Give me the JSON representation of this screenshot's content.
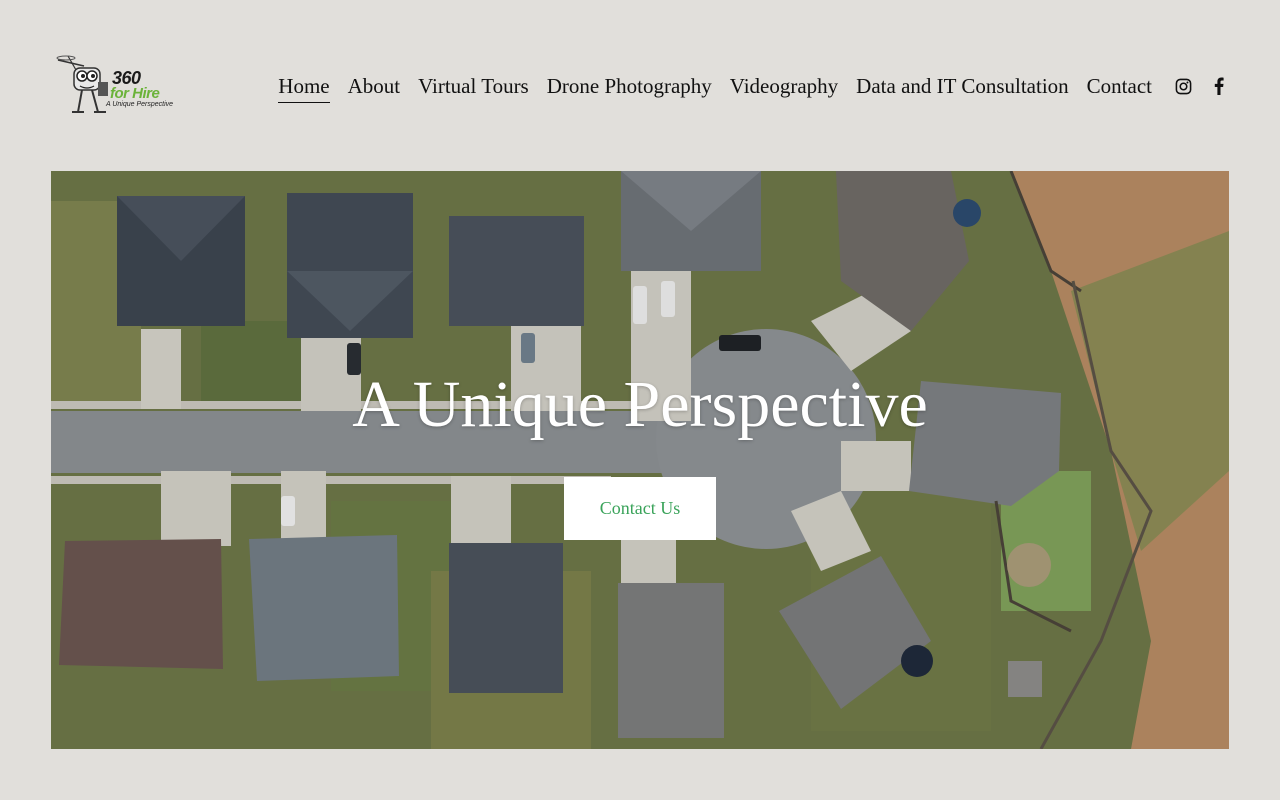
{
  "brand": {
    "logo_number": "360",
    "logo_name": "for Hire",
    "logo_tagline": "A Unique Perspective",
    "accent_color": "#6bb33a"
  },
  "nav": {
    "items": [
      {
        "label": "Home",
        "active": true
      },
      {
        "label": "About",
        "active": false
      },
      {
        "label": "Virtual Tours",
        "active": false
      },
      {
        "label": "Drone Photography",
        "active": false
      },
      {
        "label": "Videography",
        "active": false
      },
      {
        "label": "Data and IT Consultation",
        "active": false
      },
      {
        "label": "Contact",
        "active": false
      }
    ],
    "social": [
      {
        "icon": "instagram-icon"
      },
      {
        "icon": "facebook-icon"
      }
    ]
  },
  "hero": {
    "title": "A Unique Perspective",
    "button_label": "Contact Us",
    "button_text_color": "#3aa35a",
    "image_description_icon": "aerial-neighborhood-image"
  },
  "colors": {
    "background": "#e1dfdb",
    "text": "#111111"
  }
}
